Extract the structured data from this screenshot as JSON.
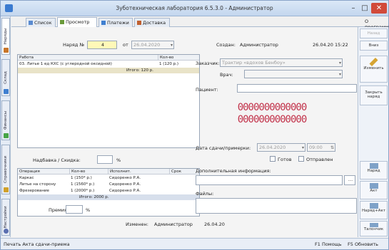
{
  "window": {
    "title": "Зуботехническая лаборатория 6.5.3.0 - Администратор",
    "minimize": "–",
    "maximize": "□",
    "close": "✕"
  },
  "left_tabs": [
    {
      "label": "Наряды",
      "color": "#c8762a"
    },
    {
      "label": "Склад",
      "color": "#3f7fd0"
    },
    {
      "label": "Финансы",
      "color": "#47a447"
    },
    {
      "label": "Справочники",
      "color": "#d0a02a"
    },
    {
      "label": "Настройки",
      "color": "#5a6fb0"
    }
  ],
  "tabs": [
    {
      "label": "Список",
      "color": "#5a8bd0"
    },
    {
      "label": "Просмотр",
      "color": "#6a9a3a"
    },
    {
      "label": "Платежи",
      "color": "#3f7fd0"
    },
    {
      "label": "Доставка",
      "color": "#c06030"
    }
  ],
  "top_right_label": "О программе",
  "order": {
    "number_label": "Наряд №",
    "number": "4",
    "date_prefix": "от",
    "date": "26.04.2020",
    "created_label": "Создан:",
    "created_by": "Администратор",
    "created_at": "26.04.20 15:22"
  },
  "works_table": {
    "headers": [
      "Работа",
      "Кол-во"
    ],
    "rows": [
      {
        "name": "03. Литье 1 ед КХС (с углеродной оксидной)",
        "qty": "1 (120 р.)"
      }
    ],
    "total": "Итого: 120 р."
  },
  "markup": {
    "label": "Надбавка / Скидка:",
    "value": "",
    "unit": "%"
  },
  "ops_table": {
    "headers": [
      "Операция",
      "Кол-во",
      "Исполнит.",
      "Срок"
    ],
    "rows": [
      {
        "op": "Каркас",
        "qty": "1 (150* р.)",
        "who": "Сидоренко Р.А.",
        "term": ""
      },
      {
        "op": "Литье на сторону",
        "qty": "1 (1560* р.)",
        "who": "Сидоренко Р.А.",
        "term": ""
      },
      {
        "op": "Фрезерование",
        "qty": "1 (2000* р.)",
        "who": "Сидоренко Р.А.",
        "term": ""
      }
    ],
    "total": "Итого: 2000 р."
  },
  "bonus": {
    "label": "Премия:",
    "value": "",
    "unit": "%"
  },
  "customer": {
    "label": "Заказчик:",
    "value": "Трактир «вдохов Бенбоу»",
    "doctor_label": "Врач:",
    "patient_label": "Пациент:"
  },
  "barcode_text": "0000000000000",
  "delivery": {
    "label": "Дата сдачи/примерки:",
    "date": "26.04.2020",
    "time": "09:00",
    "ready_label": "Готов",
    "sent_label": "Отправлен",
    "extra_label": "Дополнительная информация:",
    "files_label": "Файлы:"
  },
  "changed": {
    "label": "Изменен:",
    "by": "Администратор",
    "at": "26.04.20"
  },
  "right_buttons": {
    "back": "Назад",
    "forward": "Вниз",
    "edit": "Изменить",
    "close_order": "Закрыть наряд",
    "order": "Наряд",
    "act": "Акт",
    "order_act": "Наряд+Акт",
    "ticket": "Талончик"
  },
  "statusbar": {
    "left": "Печать Акта сдачи-приема",
    "f1": "F1 Помощь",
    "f5": "F5 Обновить"
  }
}
